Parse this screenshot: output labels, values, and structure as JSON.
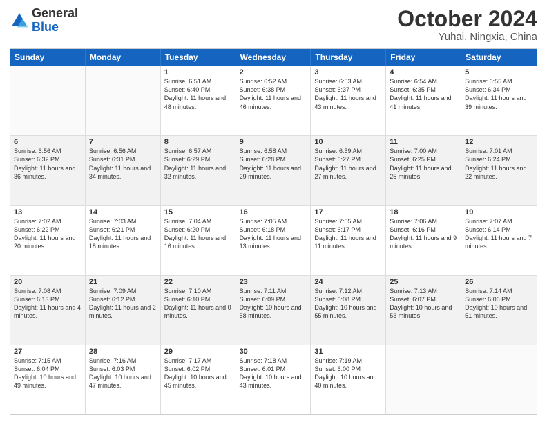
{
  "logo": {
    "general": "General",
    "blue": "Blue"
  },
  "title": "October 2024",
  "subtitle": "Yuhai, Ningxia, China",
  "days_header": [
    "Sunday",
    "Monday",
    "Tuesday",
    "Wednesday",
    "Thursday",
    "Friday",
    "Saturday"
  ],
  "weeks": [
    [
      {
        "day": "",
        "empty": true
      },
      {
        "day": "",
        "empty": true
      },
      {
        "day": "1",
        "sunrise": "6:51 AM",
        "sunset": "6:40 PM",
        "daylight": "11 hours and 48 minutes."
      },
      {
        "day": "2",
        "sunrise": "6:52 AM",
        "sunset": "6:38 PM",
        "daylight": "11 hours and 46 minutes."
      },
      {
        "day": "3",
        "sunrise": "6:53 AM",
        "sunset": "6:37 PM",
        "daylight": "11 hours and 43 minutes."
      },
      {
        "day": "4",
        "sunrise": "6:54 AM",
        "sunset": "6:35 PM",
        "daylight": "11 hours and 41 minutes."
      },
      {
        "day": "5",
        "sunrise": "6:55 AM",
        "sunset": "6:34 PM",
        "daylight": "11 hours and 39 minutes."
      }
    ],
    [
      {
        "day": "6",
        "sunrise": "6:56 AM",
        "sunset": "6:32 PM",
        "daylight": "11 hours and 36 minutes."
      },
      {
        "day": "7",
        "sunrise": "6:56 AM",
        "sunset": "6:31 PM",
        "daylight": "11 hours and 34 minutes."
      },
      {
        "day": "8",
        "sunrise": "6:57 AM",
        "sunset": "6:29 PM",
        "daylight": "11 hours and 32 minutes."
      },
      {
        "day": "9",
        "sunrise": "6:58 AM",
        "sunset": "6:28 PM",
        "daylight": "11 hours and 29 minutes."
      },
      {
        "day": "10",
        "sunrise": "6:59 AM",
        "sunset": "6:27 PM",
        "daylight": "11 hours and 27 minutes."
      },
      {
        "day": "11",
        "sunrise": "7:00 AM",
        "sunset": "6:25 PM",
        "daylight": "11 hours and 25 minutes."
      },
      {
        "day": "12",
        "sunrise": "7:01 AM",
        "sunset": "6:24 PM",
        "daylight": "11 hours and 22 minutes."
      }
    ],
    [
      {
        "day": "13",
        "sunrise": "7:02 AM",
        "sunset": "6:22 PM",
        "daylight": "11 hours and 20 minutes."
      },
      {
        "day": "14",
        "sunrise": "7:03 AM",
        "sunset": "6:21 PM",
        "daylight": "11 hours and 18 minutes."
      },
      {
        "day": "15",
        "sunrise": "7:04 AM",
        "sunset": "6:20 PM",
        "daylight": "11 hours and 16 minutes."
      },
      {
        "day": "16",
        "sunrise": "7:05 AM",
        "sunset": "6:18 PM",
        "daylight": "11 hours and 13 minutes."
      },
      {
        "day": "17",
        "sunrise": "7:05 AM",
        "sunset": "6:17 PM",
        "daylight": "11 hours and 11 minutes."
      },
      {
        "day": "18",
        "sunrise": "7:06 AM",
        "sunset": "6:16 PM",
        "daylight": "11 hours and 9 minutes."
      },
      {
        "day": "19",
        "sunrise": "7:07 AM",
        "sunset": "6:14 PM",
        "daylight": "11 hours and 7 minutes."
      }
    ],
    [
      {
        "day": "20",
        "sunrise": "7:08 AM",
        "sunset": "6:13 PM",
        "daylight": "11 hours and 4 minutes."
      },
      {
        "day": "21",
        "sunrise": "7:09 AM",
        "sunset": "6:12 PM",
        "daylight": "11 hours and 2 minutes."
      },
      {
        "day": "22",
        "sunrise": "7:10 AM",
        "sunset": "6:10 PM",
        "daylight": "11 hours and 0 minutes."
      },
      {
        "day": "23",
        "sunrise": "7:11 AM",
        "sunset": "6:09 PM",
        "daylight": "10 hours and 58 minutes."
      },
      {
        "day": "24",
        "sunrise": "7:12 AM",
        "sunset": "6:08 PM",
        "daylight": "10 hours and 55 minutes."
      },
      {
        "day": "25",
        "sunrise": "7:13 AM",
        "sunset": "6:07 PM",
        "daylight": "10 hours and 53 minutes."
      },
      {
        "day": "26",
        "sunrise": "7:14 AM",
        "sunset": "6:06 PM",
        "daylight": "10 hours and 51 minutes."
      }
    ],
    [
      {
        "day": "27",
        "sunrise": "7:15 AM",
        "sunset": "6:04 PM",
        "daylight": "10 hours and 49 minutes."
      },
      {
        "day": "28",
        "sunrise": "7:16 AM",
        "sunset": "6:03 PM",
        "daylight": "10 hours and 47 minutes."
      },
      {
        "day": "29",
        "sunrise": "7:17 AM",
        "sunset": "6:02 PM",
        "daylight": "10 hours and 45 minutes."
      },
      {
        "day": "30",
        "sunrise": "7:18 AM",
        "sunset": "6:01 PM",
        "daylight": "10 hours and 43 minutes."
      },
      {
        "day": "31",
        "sunrise": "7:19 AM",
        "sunset": "6:00 PM",
        "daylight": "10 hours and 40 minutes."
      },
      {
        "day": "",
        "empty": true
      },
      {
        "day": "",
        "empty": true
      }
    ]
  ]
}
